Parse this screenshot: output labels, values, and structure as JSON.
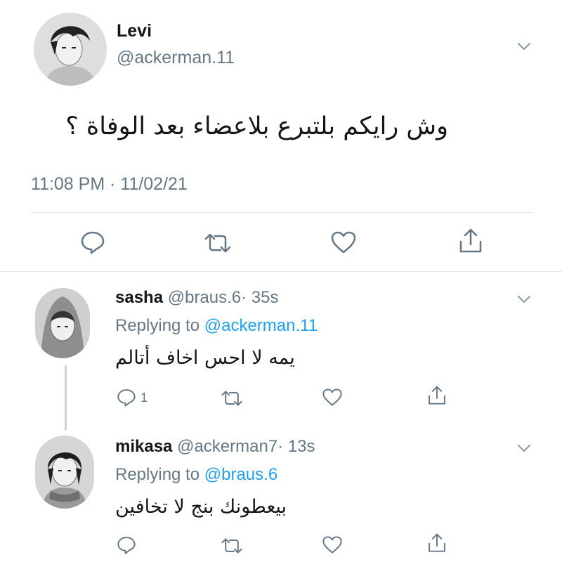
{
  "main_tweet": {
    "display_name": "Levi",
    "handle": "@ackerman.11",
    "text": "وش رايكم بلتبرع بلاعضاء بعد الوفاة ؟",
    "timestamp": "11:08 PM · 11/02/21"
  },
  "replies": [
    {
      "display_name": "sasha",
      "handle": "@braus.6",
      "time": "· 35s",
      "replying_prefix": "Replying to",
      "replying_to": "@ackerman.11",
      "text": "يمه لا احس اخاف أتالم",
      "reply_count": "1"
    },
    {
      "display_name": "mikasa",
      "handle": "@ackerman7",
      "time": "· 13s",
      "replying_prefix": "Replying to",
      "replying_to": "@braus.6",
      "text": "بيعطونك بنج لا تخافين",
      "reply_count": ""
    }
  ],
  "icons": {
    "reply": "reply-icon",
    "retweet": "retweet-icon",
    "like": "heart-icon",
    "share": "share-icon",
    "more": "chevron-down-icon"
  },
  "colors": {
    "link": "#1da1f2",
    "muted": "#657786",
    "text": "#14171a",
    "divider": "#e1e8ed"
  }
}
